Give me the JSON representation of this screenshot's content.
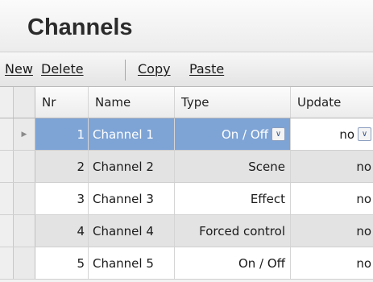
{
  "title": "Channels",
  "toolbar": {
    "new_label": "New",
    "delete_label": "Delete",
    "copy_label": "Copy",
    "paste_label": "Paste"
  },
  "columns": {
    "nr": "Nr",
    "name": "Name",
    "type": "Type",
    "update": "Update"
  },
  "rows": [
    {
      "nr": "1",
      "name": "Channel 1",
      "type": "On / Off",
      "update": "no"
    },
    {
      "nr": "2",
      "name": "Channel 2",
      "type": "Scene",
      "update": "no"
    },
    {
      "nr": "3",
      "name": "Channel 3",
      "type": "Effect",
      "update": "no"
    },
    {
      "nr": "4",
      "name": "Channel 4",
      "type": "Forced control",
      "update": "no"
    },
    {
      "nr": "5",
      "name": "Channel 5",
      "type": "On / Off",
      "update": "no"
    }
  ],
  "selected_row": 1,
  "icons": {
    "row_indicator": "row-pointer-icon",
    "dropdown": "chevron-down-icon"
  },
  "colors": {
    "selection": "#7ea4d6",
    "alt_row": "#e3e3e3"
  }
}
